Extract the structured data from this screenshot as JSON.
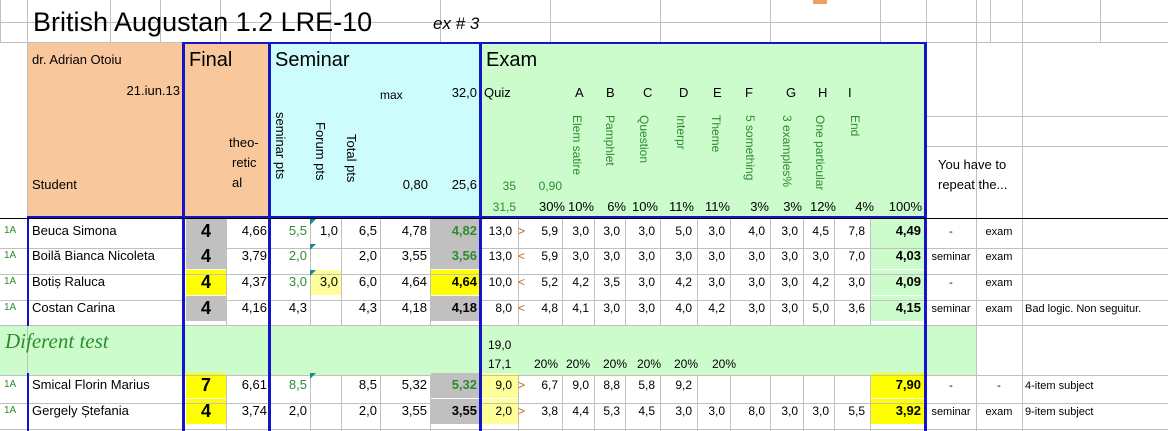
{
  "header": {
    "title": "British Augustan 1.2 LRE-10",
    "subtitle": "ex # 3",
    "teacher": "dr. Adrian Otoiu",
    "date": "21.iun.13",
    "student_label": "Student",
    "final_label": "Final",
    "theoretical_label": [
      "theo-",
      "retic",
      "al"
    ],
    "seminar_label": "Seminar",
    "seminar_max_label": "max",
    "seminar_max_value": "32,0",
    "seminar_cols": [
      "seminar pts",
      "Forum pts",
      "Total pts"
    ],
    "seminar_weight": "0,80",
    "seminar_weighted_max": "25,6",
    "exam_label": "Exam",
    "quiz_label": "Quiz",
    "exam_letters": [
      "A",
      "B",
      "C",
      "D",
      "E",
      "F",
      "G",
      "H",
      "I"
    ],
    "exam_item_names": [
      "Elem satire",
      "Pamphlet",
      "Question",
      "Interpr",
      "Theme",
      "5 something",
      "3 examples%",
      "One particular",
      "End"
    ],
    "quiz_max": "35",
    "quiz_weight": "0,90",
    "quiz_weighted": "31,5",
    "exam_pcts": [
      "30%",
      "10%",
      "6%",
      "10%",
      "11%",
      "11%",
      "3%",
      "3%",
      "12%",
      "4%"
    ],
    "total_pct": "100%",
    "repeat_label": [
      "You have to",
      "repeat the..."
    ]
  },
  "rows": [
    {
      "group": "1A",
      "name": "Beuca Simona",
      "final": "4",
      "theor": "4,66",
      "sem": "5,5",
      "forum": "1,0",
      "total": "6,5",
      "weighted": "4,78",
      "semgrade": "4,82",
      "quiz": "13,0",
      "arrow": ">",
      "quizw": "5,9",
      "ex": [
        "3,0",
        "3,0",
        "3,0",
        "5,0",
        "3,0",
        "4,0",
        "3,0",
        "4,5",
        "7,8"
      ],
      "examgrade": "4,49",
      "rep1": "-",
      "rep2": "exam",
      "note": ""
    },
    {
      "group": "1A",
      "name": "Boilă Bianca Nicoleta",
      "final": "4",
      "theor": "3,79",
      "sem": "2,0",
      "forum": "",
      "total": "2,0",
      "weighted": "3,55",
      "semgrade": "3,56",
      "quiz": "13,0",
      "arrow": "<",
      "quizw": "5,9",
      "ex": [
        "3,0",
        "3,0",
        "3,0",
        "3,0",
        "3,0",
        "3,0",
        "3,0",
        "3,0",
        "7,0"
      ],
      "examgrade": "4,03",
      "rep1": "seminar",
      "rep2": "exam",
      "note": ""
    },
    {
      "group": "1A",
      "name": "Botiș Raluca",
      "final": "4",
      "theor": "4,37",
      "sem": "3,0",
      "forum": "3,0",
      "total": "6,0",
      "weighted": "4,64",
      "semgrade": "4,64",
      "quiz": "10,0",
      "arrow": "<",
      "quizw": "5,2",
      "ex": [
        "4,2",
        "3,5",
        "3,0",
        "4,2",
        "3,0",
        "3,0",
        "3,0",
        "4,2",
        "3,0"
      ],
      "examgrade": "4,09",
      "rep1": "-",
      "rep2": "exam",
      "note": ""
    },
    {
      "group": "1A",
      "name": "Costan Carina",
      "final": "4",
      "theor": "4,16",
      "sem": "4,3",
      "forum": "",
      "total": "4,3",
      "weighted": "4,18",
      "semgrade": "4,18",
      "quiz": "8,0",
      "arrow": "<",
      "quizw": "4,8",
      "ex": [
        "4,1",
        "3,0",
        "3,0",
        "4,0",
        "4,2",
        "3,0",
        "3,0",
        "5,0",
        "3,6"
      ],
      "examgrade": "4,15",
      "rep1": "seminar",
      "rep2": "exam",
      "note": "Bad logic. Non seguitur."
    }
  ],
  "different": {
    "label": "Diferent test",
    "quiz_max": "19,0",
    "quiz_weighted": "17,1",
    "pcts": [
      "20%",
      "20%",
      "20%",
      "20%",
      "20%",
      "20%"
    ]
  },
  "rows2": [
    {
      "group": "1A",
      "name": "Smical Florin Marius",
      "final": "7",
      "theor": "6,61",
      "sem": "8,5",
      "forum": "",
      "total": "8,5",
      "weighted": "5,32",
      "semgrade": "5,32",
      "quiz": "9,0",
      "arrow": ">",
      "quizw": "6,7",
      "ex": [
        "9,0",
        "8,8",
        "5,8",
        "9,2",
        "",
        "",
        "",
        "",
        ""
      ],
      "examgrade": "7,90",
      "rep1": "-",
      "rep2": "-",
      "note": "4-item subject"
    },
    {
      "group": "1A",
      "name": "Gergely Ștefania",
      "final": "4",
      "theor": "3,74",
      "sem": "2,0",
      "forum": "",
      "total": "2,0",
      "weighted": "3,55",
      "semgrade": "3,55",
      "quiz": "2,0",
      "arrow": ">",
      "quizw": "3,8",
      "ex": [
        "4,4",
        "5,3",
        "4,5",
        "3,0",
        "3,0",
        "8,0",
        "3,0",
        "3,0",
        "5,5"
      ],
      "examgrade": "3,92",
      "rep1": "seminar",
      "rep2": "exam",
      "note": "9-item subject"
    }
  ],
  "colors": {
    "final": "#f8c89c",
    "seminar": "#ccfcfc",
    "exam": "#ccfccc",
    "grey": "#c0c0c0",
    "yellow": "#ffff00",
    "lightyellow": "#ffff99",
    "frame": "#1414c8"
  }
}
